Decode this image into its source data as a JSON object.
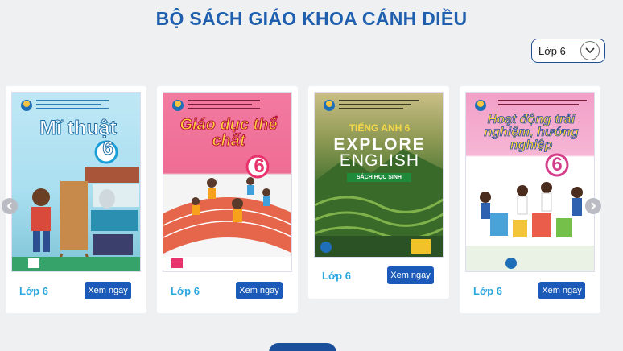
{
  "page": {
    "title": "BỘ SÁCH GIÁO KHOA CÁNH DIỀU"
  },
  "filter": {
    "selected": "Lớp 6"
  },
  "books": [
    {
      "cover_title": "Mĩ thuật",
      "cover_number": "6",
      "grade": "Lớp 6",
      "button": "Xem ngay",
      "accent": "#2aa8df"
    },
    {
      "cover_title": "Giáo dục thể chất",
      "cover_number": "6",
      "grade": "Lớp 6",
      "button": "Xem ngay",
      "accent": "#e8336d"
    },
    {
      "cover_title_line1": "TIẾNG ANH 6",
      "cover_title_line2": "EXPLORE",
      "cover_title_line3": "ENGLISH",
      "cover_subtitle": "SÁCH HỌC SINH",
      "grade": "Lớp 6",
      "button": "Xem ngay",
      "accent": "#e6c23a"
    },
    {
      "cover_title": "Hoạt động trải nghiệm, hướng nghiệp",
      "cover_number": "6",
      "grade": "Lớp 6",
      "button": "Xem ngay",
      "accent": "#d43d8a"
    }
  ],
  "icons": {
    "prev": "chevron-left-icon",
    "next": "chevron-right-icon",
    "dropdown": "chevron-down-icon"
  },
  "colors": {
    "title": "#1f5fae",
    "button": "#1b5ab8",
    "grade_text": "#2aa8df",
    "background": "#eef0f2"
  }
}
